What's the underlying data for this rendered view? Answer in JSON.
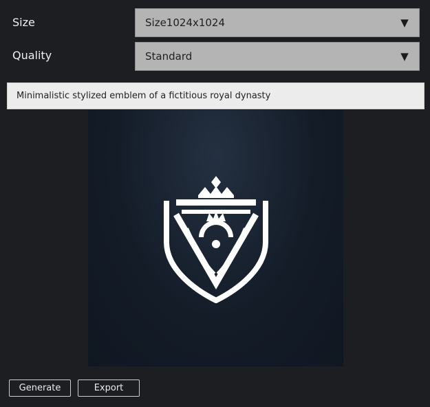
{
  "settings": {
    "size_label": "Size",
    "size_value": "Size1024x1024",
    "quality_label": "Quality",
    "quality_value": "Standard",
    "dropdown_arrow": "▼"
  },
  "prompt": {
    "text": "Minimalistic stylized emblem of a fictitious royal dynasty"
  },
  "image": {
    "icon": "royal-crest-emblem-icon",
    "background_color": "#141c28",
    "emblem_color": "#ffffff"
  },
  "actions": {
    "generate_label": "Generate",
    "export_label": "Export"
  }
}
